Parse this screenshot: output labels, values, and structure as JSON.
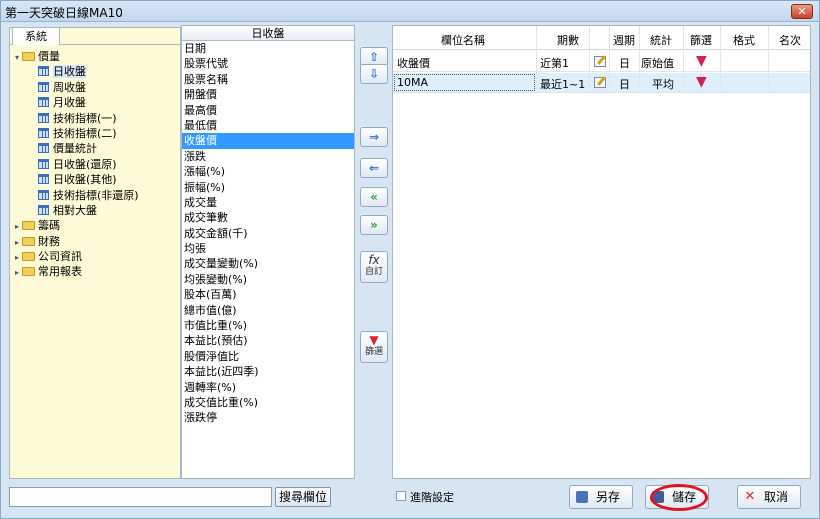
{
  "window": {
    "title": "第一天突破日線MA10",
    "close_label": "✕"
  },
  "left": {
    "tab": "系統",
    "tree": [
      {
        "label": "價量",
        "type": "folder",
        "expanded": true
      },
      {
        "label": "日收盤",
        "type": "item",
        "selected": true
      },
      {
        "label": "周收盤",
        "type": "item"
      },
      {
        "label": "月收盤",
        "type": "item"
      },
      {
        "label": "技術指標(一)",
        "type": "item"
      },
      {
        "label": "技術指標(二)",
        "type": "item"
      },
      {
        "label": "價量統計",
        "type": "item"
      },
      {
        "label": "日收盤(還原)",
        "type": "item"
      },
      {
        "label": "日收盤(其他)",
        "type": "item"
      },
      {
        "label": "技術指標(非還原)",
        "type": "item"
      },
      {
        "label": "相對大盤",
        "type": "item"
      },
      {
        "label": "籌碼",
        "type": "folder",
        "expanded": false
      },
      {
        "label": "財務",
        "type": "folder",
        "expanded": false
      },
      {
        "label": "公司資訊",
        "type": "folder",
        "expanded": false
      },
      {
        "label": "常用報表",
        "type": "folder",
        "expanded": false
      }
    ]
  },
  "middle": {
    "header": "日收盤",
    "items": [
      "日期",
      "股票代號",
      "股票名稱",
      "開盤價",
      "最高價",
      "最低價",
      "收盤價",
      "漲跌",
      "漲幅(%)",
      "振幅(%)",
      "成交量",
      "成交筆數",
      "成交金額(千)",
      "均張",
      "成交量變動(%)",
      "均張變動(%)",
      "股本(百萬)",
      "總市值(億)",
      "市值比重(%)",
      "本益比(預估)",
      "股價淨值比",
      "本益比(近四季)",
      "週轉率(%)",
      "成交值比重(%)",
      "漲跌停"
    ],
    "selected_index": 6
  },
  "side_buttons": {
    "up": "⇧",
    "down": "⇩",
    "right": "⇒",
    "left": "⇐",
    "all_left": "«",
    "all_right": "»",
    "custom_icon": "fx",
    "custom_label": "自訂",
    "filter_label": "篩選"
  },
  "grid": {
    "headers": [
      "欄位名稱",
      "期數",
      "週期",
      "統計",
      "篩選",
      "格式",
      "名次"
    ],
    "rows": [
      {
        "name": "收盤價",
        "period": "近第1",
        "cycle": "日",
        "stat": "原始值"
      },
      {
        "name": "10MA",
        "period": "最近1~1",
        "cycle": "日",
        "stat": "平均"
      }
    ]
  },
  "bottom": {
    "search_value": "",
    "search_button": "搜尋欄位",
    "advanced_label": "進階設定",
    "save_as": "另存",
    "save": "儲存",
    "cancel": "取消"
  },
  "colors": {
    "accent": "#3399ff",
    "highlight_ring": "#e0141e",
    "tree_bg": "#fdfbd7"
  }
}
